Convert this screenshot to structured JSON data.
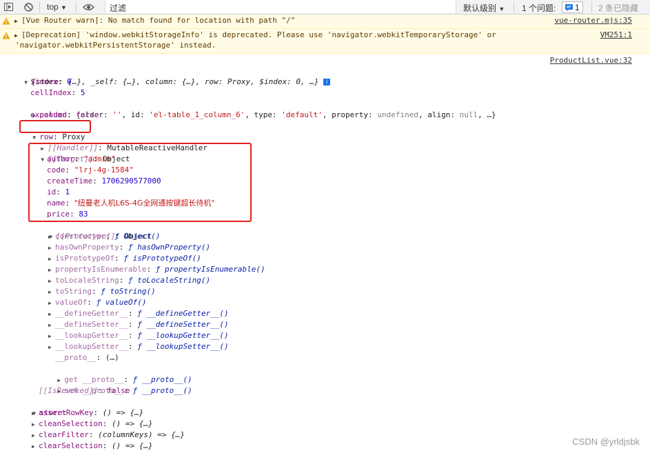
{
  "toolbar": {
    "context": "top",
    "filter_placeholder": "过滤",
    "levels": "默认级别",
    "issues_label": "1 个问题:",
    "issues_count": "1",
    "hidden": "2 条已隐藏"
  },
  "messages": [
    {
      "text": "[Vue Router warn]: No match found for location with path \"/\"",
      "source": "vue-router.mjs:35"
    },
    {
      "text": "[Deprecation] 'window.webkitStorageInfo' is deprecated. Please use 'navigator.webkitTemporaryStorage' or\n'navigator.webkitPersistentStorage' instead.",
      "source": "VM251:1"
    }
  ],
  "log_source": "ProductList.vue:32",
  "tree": {
    "root": "{store: {…}, _self: {…}, column: {…}, row: Proxy, $index: 0, …}",
    "index_key": "$index",
    "index_val": "0",
    "cellindex_key": "cellIndex",
    "cellindex_val": "5",
    "column_key": "column",
    "expanded_key": "expanded",
    "expanded_val": "false",
    "row_key": "row",
    "row_val": "Proxy",
    "handler_key": "[[Handler]]",
    "handler_val": "MutableReactiveHandler",
    "target_key": "[[Target]]",
    "target_val": "Object",
    "author_key": "author",
    "author_val": "\"admin\"",
    "code_key": "code",
    "code_val": "\"lrj-4g-1584\"",
    "ctime_key": "createTime",
    "ctime_val": "1706290577000",
    "id_key": "id",
    "id_val": "1",
    "name_key": "name",
    "name_val": "\"纽曼老人机L6S-4G全网通按键超长待机\"",
    "price_key": "price",
    "price_val": "83",
    "proto_key": "[[Prototype]]",
    "proto_val": "Object",
    "revoked_key": "[[IsRevoked]]",
    "revoked_val": "false",
    "store_key": "store"
  },
  "proto_methods": [
    {
      "key": "constructor",
      "val": "Object()"
    },
    {
      "key": "hasOwnProperty",
      "val": "hasOwnProperty()"
    },
    {
      "key": "isPrototypeOf",
      "val": "isPrototypeOf()"
    },
    {
      "key": "propertyIsEnumerable",
      "val": "propertyIsEnumerable()"
    },
    {
      "key": "toLocaleString",
      "val": "toLocaleString()"
    },
    {
      "key": "toString",
      "val": "toString()"
    },
    {
      "key": "valueOf",
      "val": "valueOf()"
    },
    {
      "key": "__defineGetter__",
      "val": "__defineGetter__()"
    },
    {
      "key": "__defineSetter__",
      "val": "__defineSetter__()"
    },
    {
      "key": "__lookupGetter__",
      "val": "__lookupGetter__()"
    },
    {
      "key": "__lookupSetter__",
      "val": "__lookupSetter__()"
    }
  ],
  "proto_extra": {
    "proto_key": "__proto__",
    "proto_val": "(…)",
    "get_key": "get __proto__",
    "get_val": "__proto__()",
    "set_key": "set __proto__",
    "set_val": "__proto__()"
  },
  "store_methods": [
    {
      "key": "assertRowKey",
      "val": "() => {…}"
    },
    {
      "key": "cleanSelection",
      "val": "() => {…}"
    },
    {
      "key": "clearFilter",
      "val": "(columnKeys) => {…}"
    },
    {
      "key": "clearSelection",
      "val": "() => {…}"
    }
  ],
  "watermark": "CSDN @yrldjsbk",
  "colors": {
    "highlight_box": "#e02020",
    "warn_bg": "#fffbe5",
    "key": "#881280",
    "string": "#c41a16",
    "number": "#1c00cf"
  }
}
